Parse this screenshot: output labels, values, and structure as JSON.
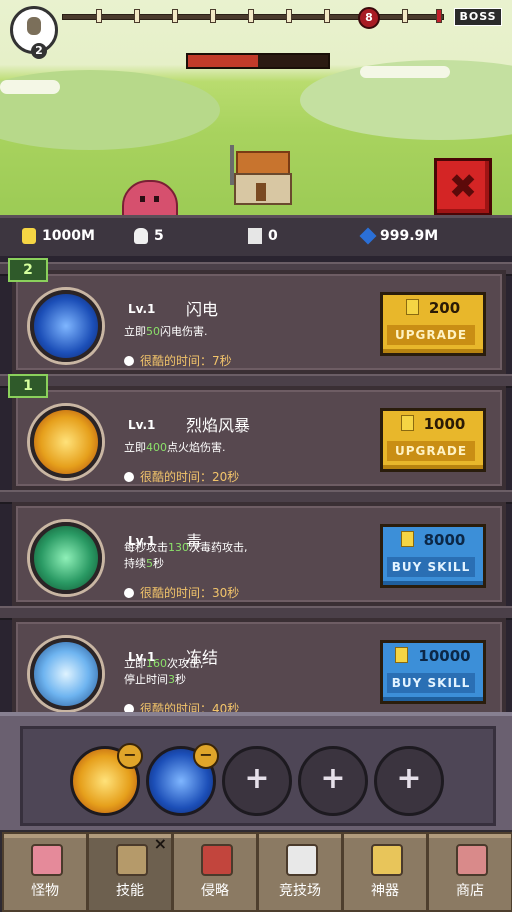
{
  "hud": {
    "player_level": "2",
    "stage_marker": "8",
    "boss_label": "BOSS",
    "boss_hp_fraction": 0.5
  },
  "resources": {
    "gold": "1000M",
    "skulls": "5",
    "tower": "0",
    "gems": "999.9M"
  },
  "skills": [
    {
      "slot_tag": "2",
      "level": "Lv.1",
      "name": "闪电",
      "desc_pre": "立即",
      "desc_num": "50",
      "desc_post": "闪电伤害.",
      "cooldown_label": "很酷的时间：",
      "cooldown_value": "7秒",
      "price": "200",
      "action": "UPGRADE",
      "orb_color": "#1c4fb8"
    },
    {
      "slot_tag": "1",
      "level": "Lv.1",
      "name": "烈焰风暴",
      "desc_pre": "立即",
      "desc_num": "400",
      "desc_post": "点火焰伤害.",
      "cooldown_label": "很酷的时间：",
      "cooldown_value": "20秒",
      "price": "1000",
      "action": "UPGRADE",
      "orb_color": "#e6a01c"
    },
    {
      "level": "Lv.1",
      "name": "毒",
      "desc_pre": "每秒攻击",
      "desc_num": "130",
      "desc_post": "次毒药攻击,",
      "desc_line2_pre": "持续",
      "desc_line2_num": "5",
      "desc_line2_post": "秒",
      "cooldown_label": "很酷的时间：",
      "cooldown_value": "30秒",
      "price": "8000",
      "action": "BUY SKILL",
      "orb_color": "#2a9a64"
    },
    {
      "level": "Lv.1",
      "name": "冻结",
      "desc_pre": "立即",
      "desc_num": "160",
      "desc_post": "次攻击,",
      "desc_line2_pre": "停止时间",
      "desc_line2_num": "3",
      "desc_line2_post": "秒",
      "cooldown_label": "很酷的时间：",
      "cooldown_value": "40秒",
      "price": "10000",
      "action": "BUY SKILL",
      "orb_color": "#4a8fd8"
    }
  ],
  "equip": {
    "plus_glyph": "+",
    "minus_glyph": "−"
  },
  "nav": {
    "tabs": [
      {
        "label": "怪物"
      },
      {
        "label": "技能"
      },
      {
        "label": "侵略"
      },
      {
        "label": "竞技场"
      },
      {
        "label": "神器"
      },
      {
        "label": "商店"
      }
    ],
    "close_glyph": "×"
  },
  "close_glyph": "✖"
}
